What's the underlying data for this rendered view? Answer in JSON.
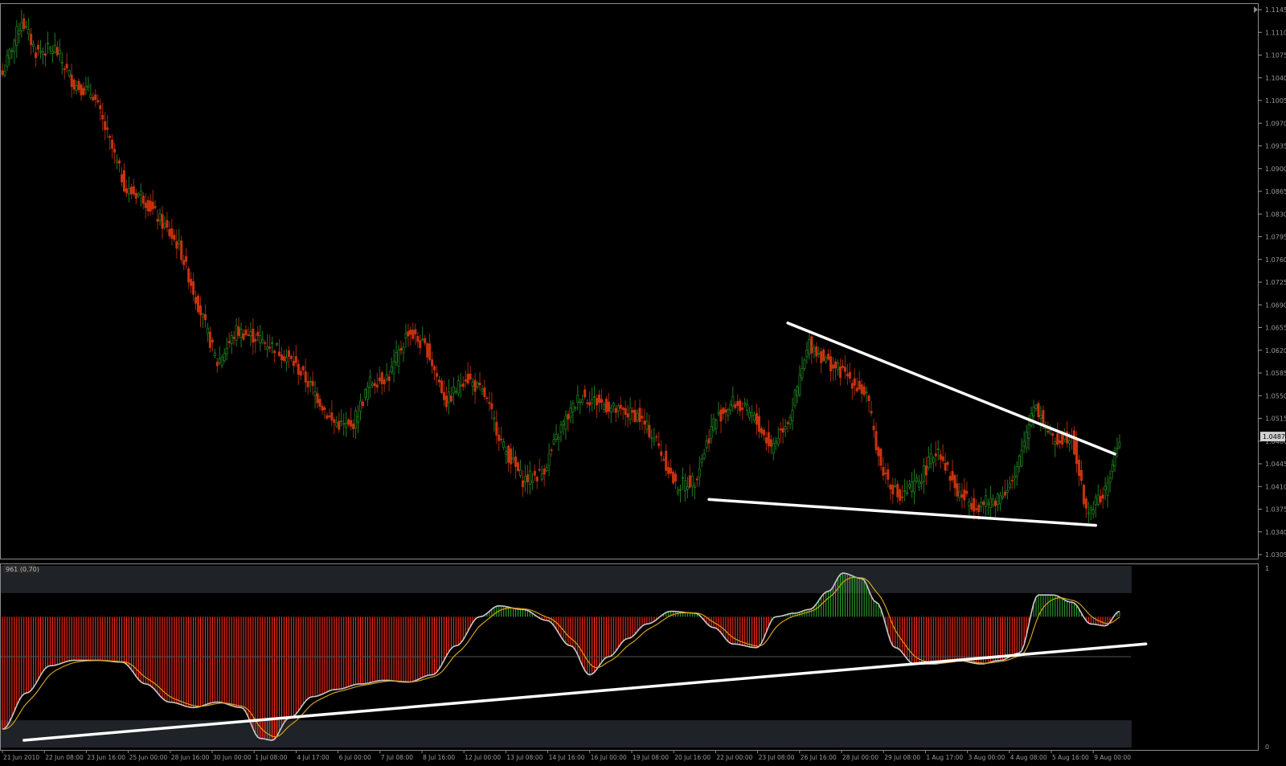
{
  "chart_data": [
    {
      "type": "candlestick",
      "title": "",
      "ylim": [
        1.0305,
        1.1145
      ],
      "y_ticks": [
        "1.1145",
        "1.1110",
        "1.1075",
        "1.1040",
        "1.1005",
        "1.0970",
        "1.0935",
        "1.0900",
        "1.0865",
        "1.0830",
        "1.0795",
        "1.0760",
        "1.0725",
        "1.0690",
        "1.0655",
        "1.0620",
        "1.0585",
        "1.0550",
        "1.0515",
        "1.0480",
        "1.0445",
        "1.0410",
        "1.0375",
        "1.0340",
        "1.0305"
      ],
      "current_price_label": "1.0487",
      "current_price": 1.0487,
      "up_color": "#1f7a1f",
      "down_color": "#c8320f",
      "trendline_color": "#ffffff",
      "anchor_closes": [
        [
          0,
          1.1045
        ],
        [
          8,
          1.113
        ],
        [
          14,
          1.108
        ],
        [
          22,
          1.1085
        ],
        [
          30,
          1.103
        ],
        [
          38,
          1.1015
        ],
        [
          46,
          1.093
        ],
        [
          52,
          1.0865
        ],
        [
          58,
          1.086
        ],
        [
          66,
          1.082
        ],
        [
          74,
          1.078
        ],
        [
          82,
          1.069
        ],
        [
          90,
          1.06
        ],
        [
          98,
          1.065
        ],
        [
          106,
          1.064
        ],
        [
          114,
          1.0625
        ],
        [
          122,
          1.06
        ],
        [
          130,
          1.056
        ],
        [
          138,
          1.051
        ],
        [
          146,
          1.05
        ],
        [
          154,
          1.057
        ],
        [
          162,
          1.058
        ],
        [
          170,
          1.065
        ],
        [
          178,
          1.062
        ],
        [
          186,
          1.054
        ],
        [
          194,
          1.058
        ],
        [
          202,
          1.055
        ],
        [
          210,
          1.047
        ],
        [
          218,
          1.042
        ],
        [
          226,
          1.043
        ],
        [
          234,
          1.05
        ],
        [
          242,
          1.055
        ],
        [
          250,
          1.054
        ],
        [
          258,
          1.0525
        ],
        [
          266,
          1.052
        ],
        [
          274,
          1.048
        ],
        [
          282,
          1.041
        ],
        [
          290,
          1.042
        ],
        [
          298,
          1.051
        ],
        [
          306,
          1.054
        ],
        [
          314,
          1.052
        ],
        [
          322,
          1.047
        ],
        [
          330,
          1.052
        ],
        [
          338,
          1.063
        ],
        [
          346,
          1.06
        ],
        [
          354,
          1.058
        ],
        [
          362,
          1.055
        ],
        [
          368,
          1.044
        ],
        [
          376,
          1.039
        ],
        [
          384,
          1.042
        ],
        [
          392,
          1.047
        ],
        [
          400,
          1.04
        ],
        [
          408,
          1.038
        ],
        [
          416,
          1.039
        ],
        [
          424,
          1.042
        ],
        [
          432,
          1.054
        ],
        [
          440,
          1.048
        ],
        [
          448,
          1.049
        ],
        [
          454,
          1.037
        ],
        [
          462,
          1.04
        ],
        [
          468,
          1.0487
        ]
      ],
      "trendlines": [
        {
          "name": "upper-resistance",
          "x": [
            329,
            466
          ],
          "y": [
            1.0662,
            1.046
          ]
        },
        {
          "name": "lower-support",
          "x": [
            296,
            458
          ],
          "y": [
            1.039,
            1.035
          ]
        }
      ],
      "x_tick_labels": [
        "21 Jun 2010",
        "22 Jun 08:00",
        "23 Jun 16:00",
        "25 Jun 00:00",
        "28 Jun 16:00",
        "30 Jun 00:00",
        "1 Jul 08:00",
        "4 Jul 17:00",
        "6 Jul 00:00",
        "7 Jul 08:00",
        "8 Jul 16:00",
        "12 Jul 00:00",
        "13 Jul 08:00",
        "14 Jul 16:00",
        "16 Jul 00:00",
        "19 Jul 08:00",
        "20 Jul 16:00",
        "22 Jul 00:00",
        "23 Jul 08:00",
        "26 Jul 16:00",
        "28 Jul 00:00",
        "29 Jul 08:00",
        "1 Aug 17:00",
        "3 Aug 00:00",
        "4 Aug 08:00",
        "5 Aug 16:00",
        "9 Aug 00:00"
      ]
    },
    {
      "type": "oscillator",
      "label": "961 (0.70)",
      "ylim": [
        0,
        1
      ],
      "y_ticks": [
        "1",
        "0"
      ],
      "histogram_pos_color": "#2e9e2e",
      "histogram_neg_color": "#ff2a1a",
      "main_line_color": "#c8c8c8",
      "signal_line_color": "#d4a017",
      "band_color": "#1f2226",
      "midline": 0.5,
      "bands": [
        [
          0.85,
          1.0
        ],
        [
          0.0,
          0.15
        ]
      ],
      "anchors": [
        [
          0,
          0.1
        ],
        [
          10,
          0.3
        ],
        [
          20,
          0.45
        ],
        [
          30,
          0.48
        ],
        [
          40,
          0.48
        ],
        [
          50,
          0.47
        ],
        [
          60,
          0.35
        ],
        [
          70,
          0.25
        ],
        [
          80,
          0.22
        ],
        [
          90,
          0.25
        ],
        [
          100,
          0.22
        ],
        [
          108,
          0.05
        ],
        [
          113,
          0.04
        ],
        [
          120,
          0.16
        ],
        [
          130,
          0.28
        ],
        [
          140,
          0.32
        ],
        [
          150,
          0.35
        ],
        [
          160,
          0.37
        ],
        [
          170,
          0.36
        ],
        [
          180,
          0.4
        ],
        [
          190,
          0.56
        ],
        [
          200,
          0.72
        ],
        [
          208,
          0.78
        ],
        [
          218,
          0.76
        ],
        [
          228,
          0.7
        ],
        [
          238,
          0.56
        ],
        [
          246,
          0.4
        ],
        [
          254,
          0.5
        ],
        [
          262,
          0.6
        ],
        [
          270,
          0.68
        ],
        [
          280,
          0.75
        ],
        [
          290,
          0.74
        ],
        [
          298,
          0.66
        ],
        [
          306,
          0.57
        ],
        [
          316,
          0.55
        ],
        [
          324,
          0.72
        ],
        [
          332,
          0.74
        ],
        [
          338,
          0.76
        ],
        [
          346,
          0.86
        ],
        [
          352,
          0.96
        ],
        [
          360,
          0.93
        ],
        [
          366,
          0.8
        ],
        [
          374,
          0.55
        ],
        [
          382,
          0.46
        ],
        [
          390,
          0.46
        ],
        [
          400,
          0.48
        ],
        [
          410,
          0.46
        ],
        [
          418,
          0.48
        ],
        [
          426,
          0.52
        ],
        [
          434,
          0.84
        ],
        [
          440,
          0.84
        ],
        [
          448,
          0.8
        ],
        [
          456,
          0.68
        ],
        [
          462,
          0.67
        ],
        [
          468,
          0.75
        ]
      ],
      "trendline": {
        "x": [
          9,
          479
        ],
        "y": [
          0.04,
          0.57
        ]
      },
      "signal_smoothing": 8
    }
  ]
}
